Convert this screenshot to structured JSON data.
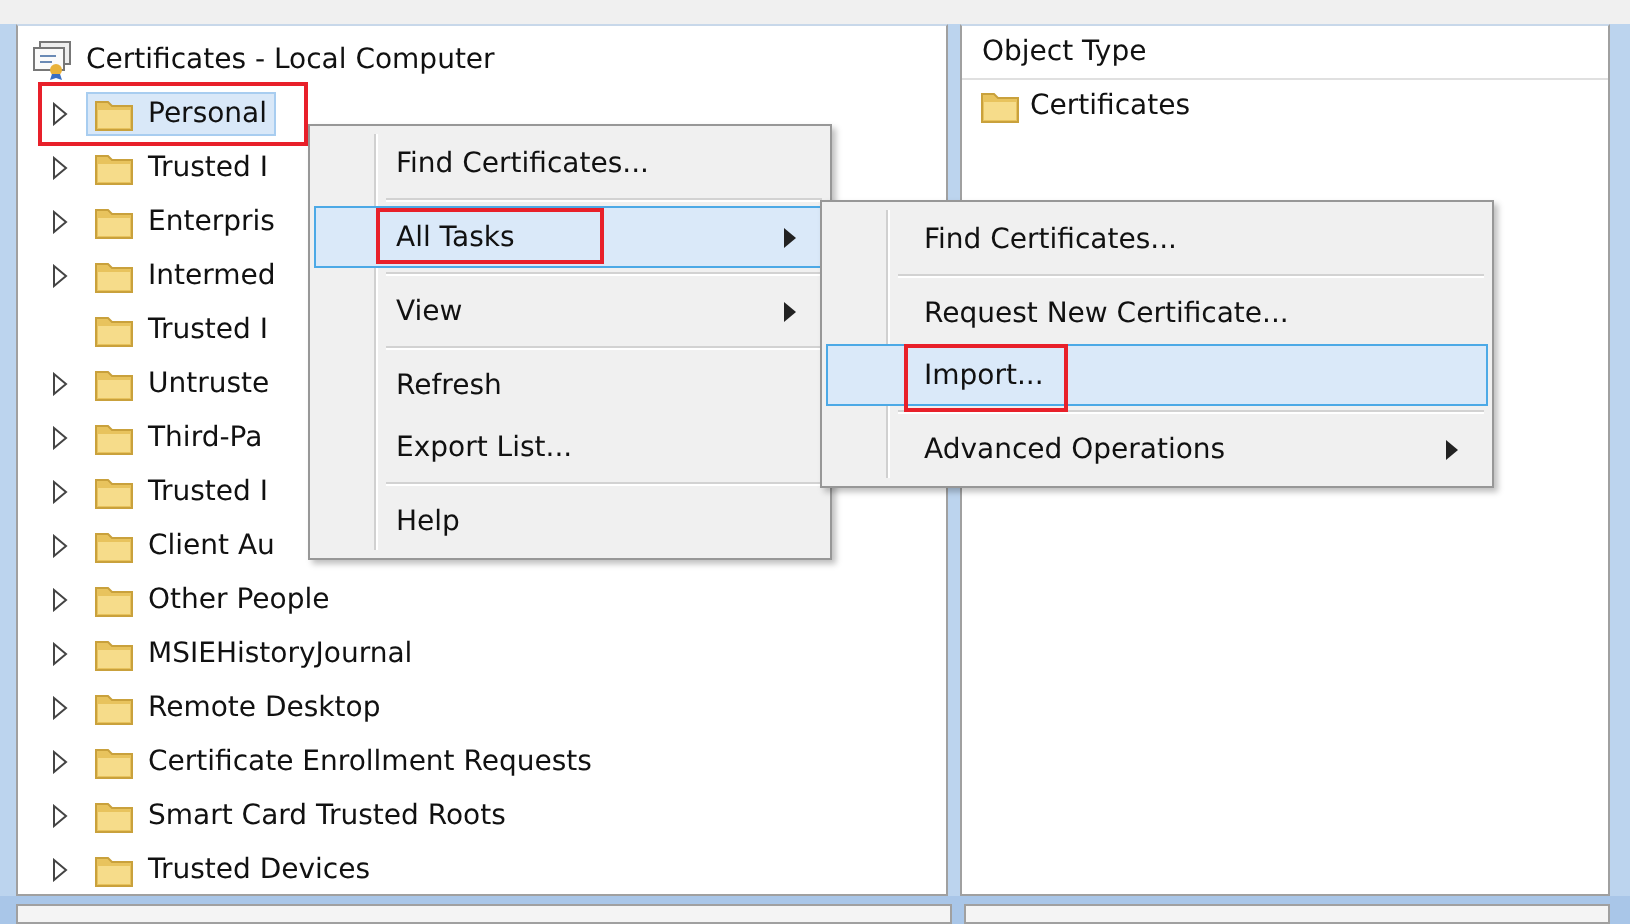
{
  "tree": {
    "root": {
      "label": "Certificates - Local Computer"
    },
    "items": [
      {
        "label": "Personal",
        "expandable": true,
        "selected": true,
        "highlight": true
      },
      {
        "label": "Trusted I",
        "expandable": true,
        "selected": false,
        "highlight": false
      },
      {
        "label": "Enterpris",
        "expandable": true,
        "selected": false,
        "highlight": false
      },
      {
        "label": "Intermed",
        "expandable": true,
        "selected": false,
        "highlight": false
      },
      {
        "label": "Trusted I",
        "expandable": false,
        "selected": false,
        "highlight": false
      },
      {
        "label": "Untruste",
        "expandable": true,
        "selected": false,
        "highlight": false
      },
      {
        "label": "Third-Pa",
        "expandable": true,
        "selected": false,
        "highlight": false
      },
      {
        "label": "Trusted I",
        "expandable": true,
        "selected": false,
        "highlight": false
      },
      {
        "label": "Client Au",
        "expandable": true,
        "selected": false,
        "highlight": false
      },
      {
        "label": "Other People",
        "expandable": true,
        "selected": false,
        "highlight": false
      },
      {
        "label": "MSIEHistoryJournal",
        "expandable": true,
        "selected": false,
        "highlight": false
      },
      {
        "label": "Remote Desktop",
        "expandable": true,
        "selected": false,
        "highlight": false
      },
      {
        "label": "Certificate Enrollment Requests",
        "expandable": true,
        "selected": false,
        "highlight": false
      },
      {
        "label": "Smart Card Trusted Roots",
        "expandable": true,
        "selected": false,
        "highlight": false
      },
      {
        "label": "Trusted Devices",
        "expandable": true,
        "selected": false,
        "highlight": false
      }
    ]
  },
  "list": {
    "columns": [
      "Object Type"
    ],
    "rows": [
      {
        "label": "Certificates"
      }
    ]
  },
  "context_menu": {
    "items": [
      {
        "kind": "item",
        "label": "Find Certificates...",
        "submenu": false,
        "selected": false,
        "highlight": false
      },
      {
        "kind": "separator"
      },
      {
        "kind": "item",
        "label": "All Tasks",
        "submenu": true,
        "selected": true,
        "highlight": true
      },
      {
        "kind": "separator"
      },
      {
        "kind": "item",
        "label": "View",
        "submenu": true,
        "selected": false,
        "highlight": false
      },
      {
        "kind": "separator"
      },
      {
        "kind": "item",
        "label": "Refresh",
        "submenu": false,
        "selected": false,
        "highlight": false
      },
      {
        "kind": "item",
        "label": "Export List...",
        "submenu": false,
        "selected": false,
        "highlight": false
      },
      {
        "kind": "separator"
      },
      {
        "kind": "item",
        "label": "Help",
        "submenu": false,
        "selected": false,
        "highlight": false
      }
    ]
  },
  "submenu": {
    "items": [
      {
        "kind": "item",
        "label": "Find Certificates...",
        "submenu": false,
        "selected": false,
        "highlight": false
      },
      {
        "kind": "separator"
      },
      {
        "kind": "item",
        "label": "Request New Certificate...",
        "submenu": false,
        "selected": false,
        "highlight": false
      },
      {
        "kind": "item",
        "label": "Import...",
        "submenu": false,
        "selected": true,
        "highlight": true
      },
      {
        "kind": "separator"
      },
      {
        "kind": "item",
        "label": "Advanced Operations",
        "submenu": true,
        "selected": false,
        "highlight": false
      }
    ]
  }
}
